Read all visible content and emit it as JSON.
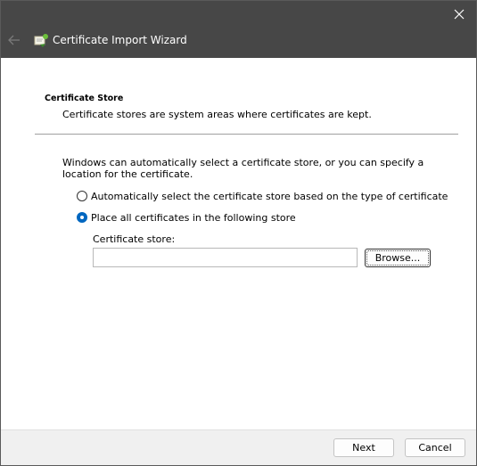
{
  "window": {
    "title": "Certificate Import Wizard",
    "icons": {
      "close": "close-icon",
      "back": "back-arrow-icon",
      "wizard": "certificate-wizard-icon"
    }
  },
  "page": {
    "heading": "Certificate Store",
    "description": "Certificate stores are system areas where certificates are kept.",
    "intro": "Windows can automatically select a certificate store, or you can specify a location for the certificate."
  },
  "options": {
    "auto_label": "Automatically select the certificate store based on the type of certificate",
    "auto_checked": false,
    "manual_label": "Place all certificates in the following store",
    "manual_checked": true
  },
  "store": {
    "label": "Certificate store:",
    "value": "",
    "browse_label": "Browse..."
  },
  "footer": {
    "next_label": "Next",
    "cancel_label": "Cancel"
  },
  "colors": {
    "titlebar": "#474747",
    "accent": "#0067c0",
    "footer": "#f0f0f0"
  }
}
